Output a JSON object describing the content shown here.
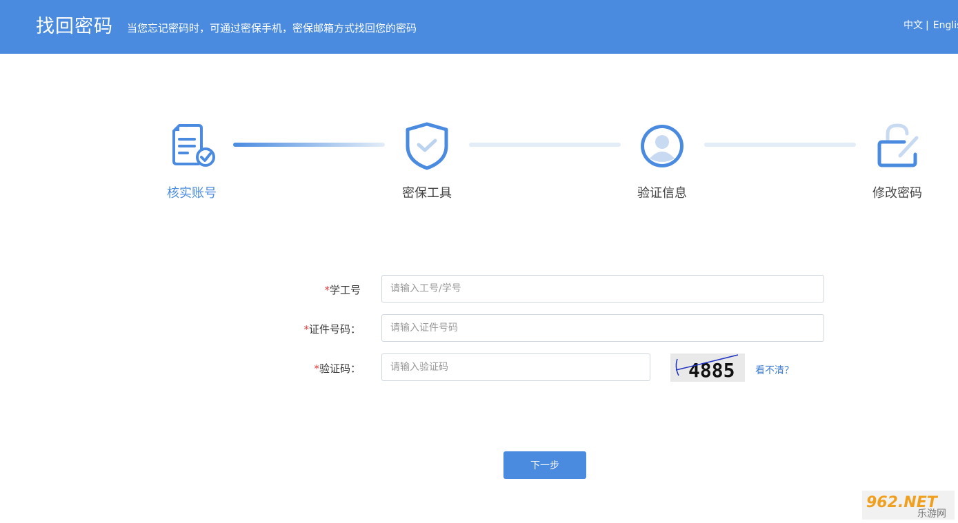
{
  "header": {
    "title": "找回密码",
    "subtitle": "当您忘记密码时，可通过密保手机，密保邮箱方式找回您的密码",
    "lang_zh": "中文",
    "lang_sep": "|",
    "lang_en": "English"
  },
  "steps": [
    {
      "label": "核实账号",
      "icon": "account-document-icon",
      "active": true
    },
    {
      "label": "密保工具",
      "icon": "shield-check-icon",
      "active": false
    },
    {
      "label": "验证信息",
      "icon": "user-avatar-icon",
      "active": false
    },
    {
      "label": "修改密码",
      "icon": "lock-edit-icon",
      "active": false
    }
  ],
  "form": {
    "required_mark": "*",
    "id_label": "学工号",
    "id_placeholder": "请输入工号/学号",
    "cert_label": "证件号码：",
    "cert_placeholder": "请输入证件号码",
    "captcha_label": "验证码：",
    "captcha_placeholder": "请输入验证码",
    "captcha_text": "4885",
    "refresh_link": "看不清？",
    "next_button": "下一步"
  },
  "watermark": {
    "brand": "962.NET",
    "sub": "乐游网"
  },
  "colors": {
    "accent": "#4a8be0",
    "required": "#e23a3a",
    "link": "#3f7dd1"
  }
}
